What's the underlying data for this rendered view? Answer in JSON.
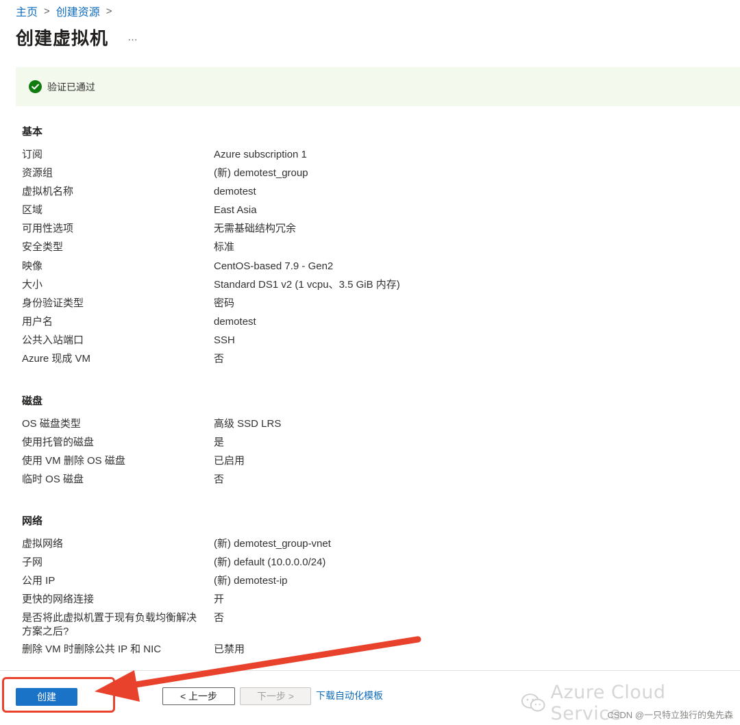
{
  "breadcrumb": {
    "home": "主页",
    "create_resource": "创建资源"
  },
  "page": {
    "title": "创建虚拟机",
    "more": "…"
  },
  "validation": {
    "text": "验证已通过",
    "color": "#107c10"
  },
  "sections": {
    "basics": {
      "title": "基本",
      "rows": [
        {
          "label": "订阅",
          "value": "Azure subscription 1"
        },
        {
          "label": "资源组",
          "value": "(新) demotest_group"
        },
        {
          "label": "虚拟机名称",
          "value": "demotest"
        },
        {
          "label": "区域",
          "value": "East Asia"
        },
        {
          "label": "可用性选项",
          "value": "无需基础结构冗余"
        },
        {
          "label": "安全类型",
          "value": "标准"
        },
        {
          "label": "映像",
          "value": "CentOS-based 7.9 - Gen2"
        },
        {
          "label": "大小",
          "value": "Standard DS1 v2 (1 vcpu、3.5 GiB 内存)"
        },
        {
          "label": "身份验证类型",
          "value": "密码"
        },
        {
          "label": "用户名",
          "value": "demotest"
        },
        {
          "label": "公共入站端口",
          "value": "SSH"
        },
        {
          "label": "Azure 现成 VM",
          "value": "否"
        }
      ]
    },
    "disks": {
      "title": "磁盘",
      "rows": [
        {
          "label": "OS 磁盘类型",
          "value": "高级 SSD LRS"
        },
        {
          "label": "使用托管的磁盘",
          "value": "是"
        },
        {
          "label": "使用 VM 删除 OS 磁盘",
          "value": "已启用"
        },
        {
          "label": "临时 OS 磁盘",
          "value": "否"
        }
      ]
    },
    "network": {
      "title": "网络",
      "rows": [
        {
          "label": "虚拟网络",
          "value": "(新) demotest_group-vnet"
        },
        {
          "label": "子网",
          "value": "(新) default (10.0.0.0/24)"
        },
        {
          "label": "公用 IP",
          "value": "(新) demotest-ip"
        },
        {
          "label": "更快的网络连接",
          "value": "开"
        },
        {
          "label": "是否将此虚拟机置于现有负载均衡解决方案之后?",
          "value": "否"
        },
        {
          "label": "删除 VM 时删除公共 IP 和 NIC",
          "value": "已禁用"
        }
      ]
    }
  },
  "footer": {
    "create_label": "创建",
    "prev_label": "< 上一步",
    "next_label": "下一步 >",
    "download_label": "下载自动化模板"
  },
  "watermark": {
    "text": "Azure Cloud Service",
    "csdn": "CSDN @一只特立独行的兔先森"
  },
  "colors": {
    "accent": "#0f6cbd",
    "primary_button": "#1a73c7",
    "annotation": "#e8412c",
    "banner_bg": "#f3f9ed"
  }
}
